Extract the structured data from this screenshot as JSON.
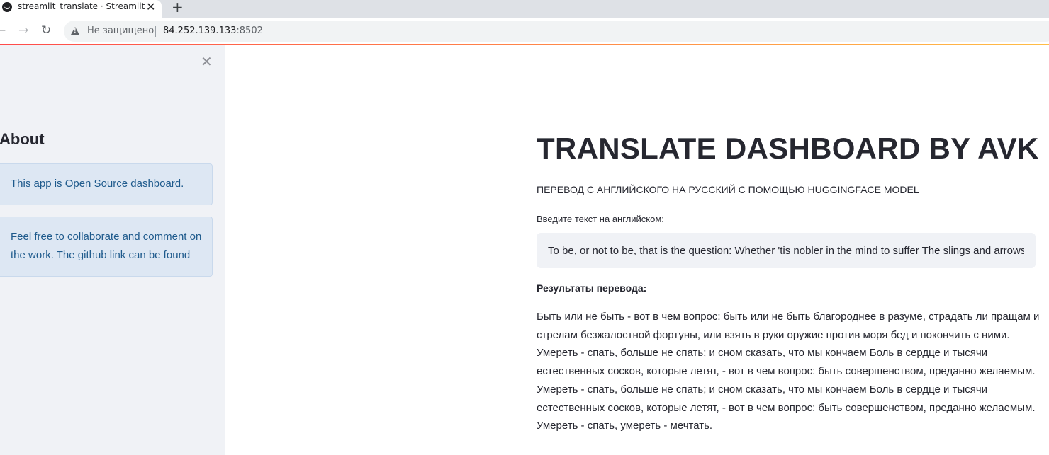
{
  "browser": {
    "tab_title": "streamlit_translate · Streamlit",
    "tab_close": "✕",
    "new_tab": "+",
    "back": "←",
    "forward": "→",
    "reload": "↻",
    "security_text": "Не защищено",
    "url_host": "84.252.139.133",
    "url_port": ":8502"
  },
  "sidebar": {
    "close": "✕",
    "title": "About",
    "info": [
      "This app is Open Source dashboard.",
      "Feel free to collaborate and comment on the work. The github link can be found"
    ]
  },
  "main": {
    "title": "TRANSLATE DASHBOARD BY AVK",
    "subtitle": "ПЕРЕВОД С АНГЛИЙСКОГО НА РУССКИЙ С ПОМОЩЬЮ HUGGINGFACE MODEL",
    "input_label": "Введите текст на английском:",
    "input_value": "To be, or not to be, that is the question: Whether 'tis nobler in the mind to suffer The slings and arrows of outrageous fortune",
    "results_label": "Результаты перевода:",
    "result_text": "Быть или не быть - вот в чем вопрос: быть или не быть благороднее в разуме, страдать ли пращам и стрелам безжалостной фортуны, или взять в руки оружие против моря бед и покончить с ними. Умереть - спать, больше не спать; и сном сказать, что мы кончаем Боль в сердце и тысячи естественных сосков, которые летят, - вот в чем вопрос: быть совершенством, преданно желаемым. Умереть - спать, больше не спать; и сном сказать, что мы кончаем Боль в сердце и тысячи естественных сосков, которые летят, - вот в чем вопрос: быть совершенством, преданно желаемым. Умереть - спать, умереть - мечтать."
  },
  "colors": {
    "accent_gradient_start": "#ff4b4b",
    "accent_gradient_end": "#ffbd45",
    "sidebar_bg": "#f0f2f6",
    "info_bg": "#dde7f3",
    "info_text": "#1e5a8c"
  }
}
